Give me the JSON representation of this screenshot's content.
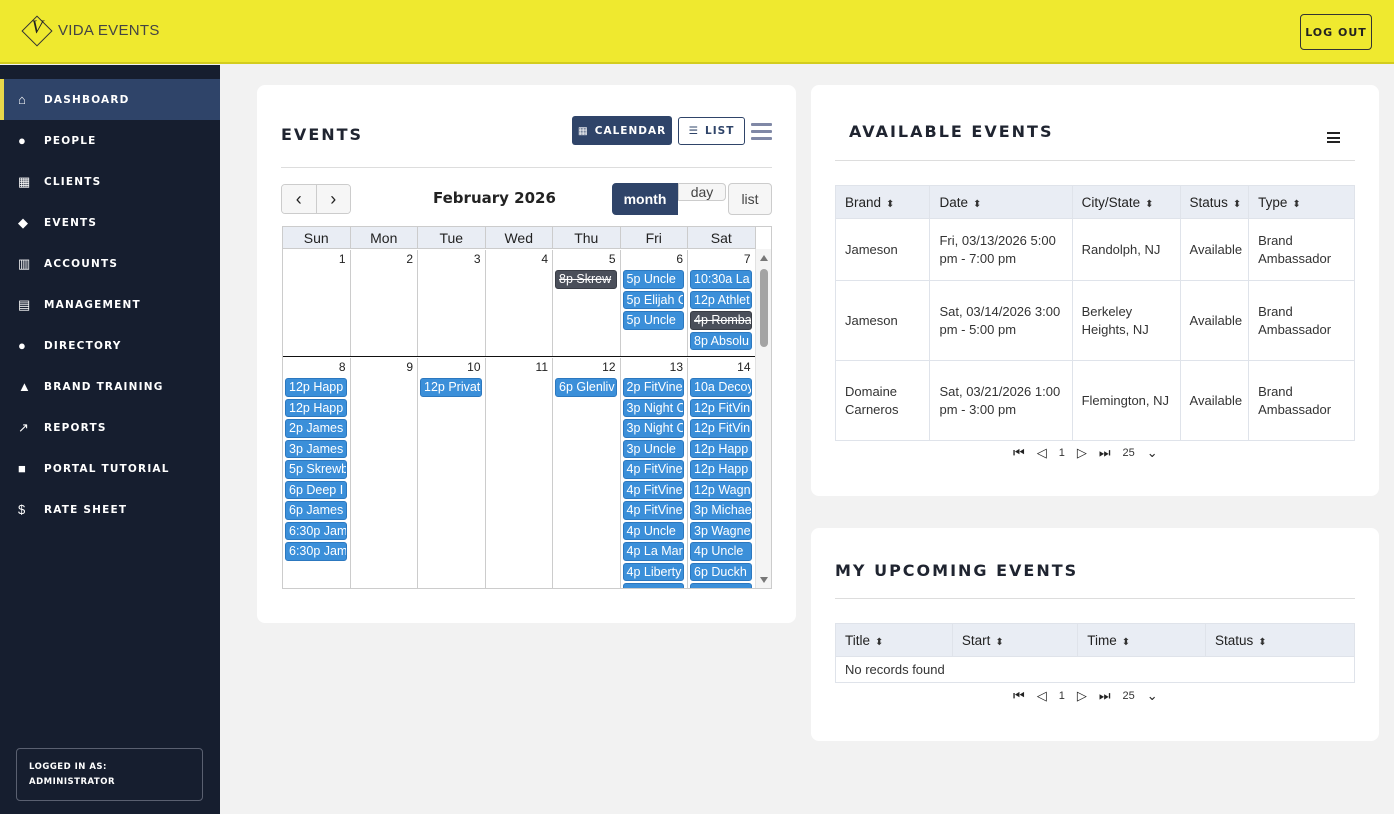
{
  "header": {
    "logo_letter": "V",
    "logo_text": "VIDA EVENTS",
    "logout_label": "LOG OUT"
  },
  "sidebar": {
    "items": [
      {
        "icon": "home-icon",
        "glyph": "⌂",
        "label": "DASHBOARD"
      },
      {
        "icon": "user-icon",
        "glyph": "●",
        "label": "PEOPLE"
      },
      {
        "icon": "building-icon",
        "glyph": "▦",
        "label": "CLIENTS"
      },
      {
        "icon": "diamond-icon",
        "glyph": "◆",
        "label": "EVENTS"
      },
      {
        "icon": "map-icon",
        "glyph": "▥",
        "label": "ACCOUNTS"
      },
      {
        "icon": "archive-icon",
        "glyph": "▤",
        "label": "MANAGEMENT"
      },
      {
        "icon": "user-icon",
        "glyph": "●",
        "label": "DIRECTORY"
      },
      {
        "icon": "graduation-cap-icon",
        "glyph": "▲",
        "label": "BRAND TRAINING"
      },
      {
        "icon": "line-chart-icon",
        "glyph": "↗",
        "label": "REPORTS"
      },
      {
        "icon": "video-camera-icon",
        "glyph": "■",
        "label": "PORTAL TUTORIAL"
      },
      {
        "icon": "dollar-icon",
        "glyph": "$",
        "label": "RATE SHEET"
      }
    ],
    "logged_in_label": "LOGGED IN AS:",
    "logged_in_user": "ADMINISTRATOR"
  },
  "events": {
    "title": "EVENTS",
    "calendar_btn": "CALENDAR",
    "list_btn": "LIST",
    "prev": "‹",
    "next": "›",
    "month_title": "February 2026",
    "views": [
      "month",
      "day",
      "list"
    ],
    "weekdays": [
      "Sun",
      "Mon",
      "Tue",
      "Wed",
      "Thu",
      "Fri",
      "Sat"
    ],
    "weeks": [
      [
        {
          "day": "1",
          "events": []
        },
        {
          "day": "2",
          "events": []
        },
        {
          "day": "3",
          "events": []
        },
        {
          "day": "4",
          "events": []
        },
        {
          "day": "5",
          "events": [
            {
              "text": "8p Skrew",
              "cancelled": true
            }
          ]
        },
        {
          "day": "6",
          "events": [
            {
              "text": "5p Uncle"
            },
            {
              "text": "5p Elijah C"
            },
            {
              "text": "5p Uncle"
            }
          ]
        },
        {
          "day": "7",
          "events": [
            {
              "text": "10:30a La"
            },
            {
              "text": "12p Athlet"
            },
            {
              "text": "4p Romba",
              "cancelled": true
            },
            {
              "text": "8p Absolu"
            }
          ]
        }
      ],
      [
        {
          "day": "8",
          "events": [
            {
              "text": "12p Happ"
            },
            {
              "text": "12p Happ"
            },
            {
              "text": "2p James"
            },
            {
              "text": "3p James"
            },
            {
              "text": "5p Skrewb"
            },
            {
              "text": "6p Deep I"
            },
            {
              "text": "6p James"
            },
            {
              "text": "6:30p Jam"
            },
            {
              "text": "6:30p Jam"
            }
          ]
        },
        {
          "day": "9",
          "events": []
        },
        {
          "day": "10",
          "events": [
            {
              "text": "12p Privat"
            }
          ]
        },
        {
          "day": "11",
          "events": []
        },
        {
          "day": "12",
          "events": [
            {
              "text": "6p Glenliv"
            }
          ]
        },
        {
          "day": "13",
          "events": [
            {
              "text": "2p FitVine"
            },
            {
              "text": "3p Night C"
            },
            {
              "text": "3p Night C"
            },
            {
              "text": "3p Uncle"
            },
            {
              "text": "4p FitVine"
            },
            {
              "text": "4p FitVine"
            },
            {
              "text": "4p FitVine"
            },
            {
              "text": "4p Uncle"
            },
            {
              "text": "4p La Mar"
            },
            {
              "text": "4p Liberty"
            },
            {
              "text": ""
            }
          ]
        },
        {
          "day": "14",
          "events": [
            {
              "text": "10a Decoy"
            },
            {
              "text": "12p FitVin"
            },
            {
              "text": "12p FitVin"
            },
            {
              "text": "12p Happ"
            },
            {
              "text": "12p Happ"
            },
            {
              "text": "12p Wagn"
            },
            {
              "text": "3p Michae"
            },
            {
              "text": "3p Wagne"
            },
            {
              "text": "4p Uncle"
            },
            {
              "text": "6p Duckh"
            },
            {
              "text": ""
            }
          ]
        }
      ]
    ]
  },
  "available": {
    "title": "AVAILABLE EVENTS",
    "columns": [
      "Brand",
      "Date",
      "City/State",
      "Status",
      "Type"
    ],
    "rows": [
      [
        "Jameson",
        "Fri, 03/13/2026 5:00 pm - 7:00 pm",
        "Randolph, NJ",
        "Available",
        "Brand Ambassador"
      ],
      [
        "Jameson",
        "Sat, 03/14/2026 3:00 pm - 5:00 pm",
        "Berkeley Heights, NJ",
        "Available",
        "Brand Ambassador"
      ],
      [
        "Domaine Carneros",
        "Sat, 03/21/2026 1:00 pm - 3:00 pm",
        "Flemington, NJ",
        "Available",
        "Brand Ambassador"
      ]
    ],
    "page": "1",
    "page_size": "25"
  },
  "upcoming": {
    "title": "MY UPCOMING EVENTS",
    "columns": [
      "Title",
      "Start",
      "Time",
      "Status"
    ],
    "empty": "No records found",
    "page": "1",
    "page_size": "25"
  },
  "colors": {
    "topbar": "#efe92f",
    "sidebar": "#161e2f",
    "accent": "#2f4469",
    "event": "#3b8fd9",
    "event_cancelled": "#4a4f5a"
  }
}
